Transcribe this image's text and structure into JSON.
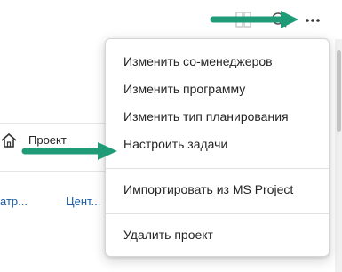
{
  "menu": {
    "items": [
      {
        "label": "Изменить со-менеджеров"
      },
      {
        "label": "Изменить программу"
      },
      {
        "label": "Изменить тип планирования"
      },
      {
        "label": "Настроить задачи"
      },
      {
        "label": "Импортировать из MS Project"
      },
      {
        "label": "Удалить проект"
      }
    ]
  },
  "background": {
    "project_label": "Проект",
    "link_left": "атр...",
    "link_right": "Цент..."
  },
  "icons": {
    "more": "more-horizontal-icon",
    "home": "home-icon",
    "search": "search-icon",
    "grid": "grid-icon"
  },
  "colors": {
    "arrow": "#1f9b78",
    "link": "#1a5ea8",
    "menu_border": "#d6d6d6"
  }
}
